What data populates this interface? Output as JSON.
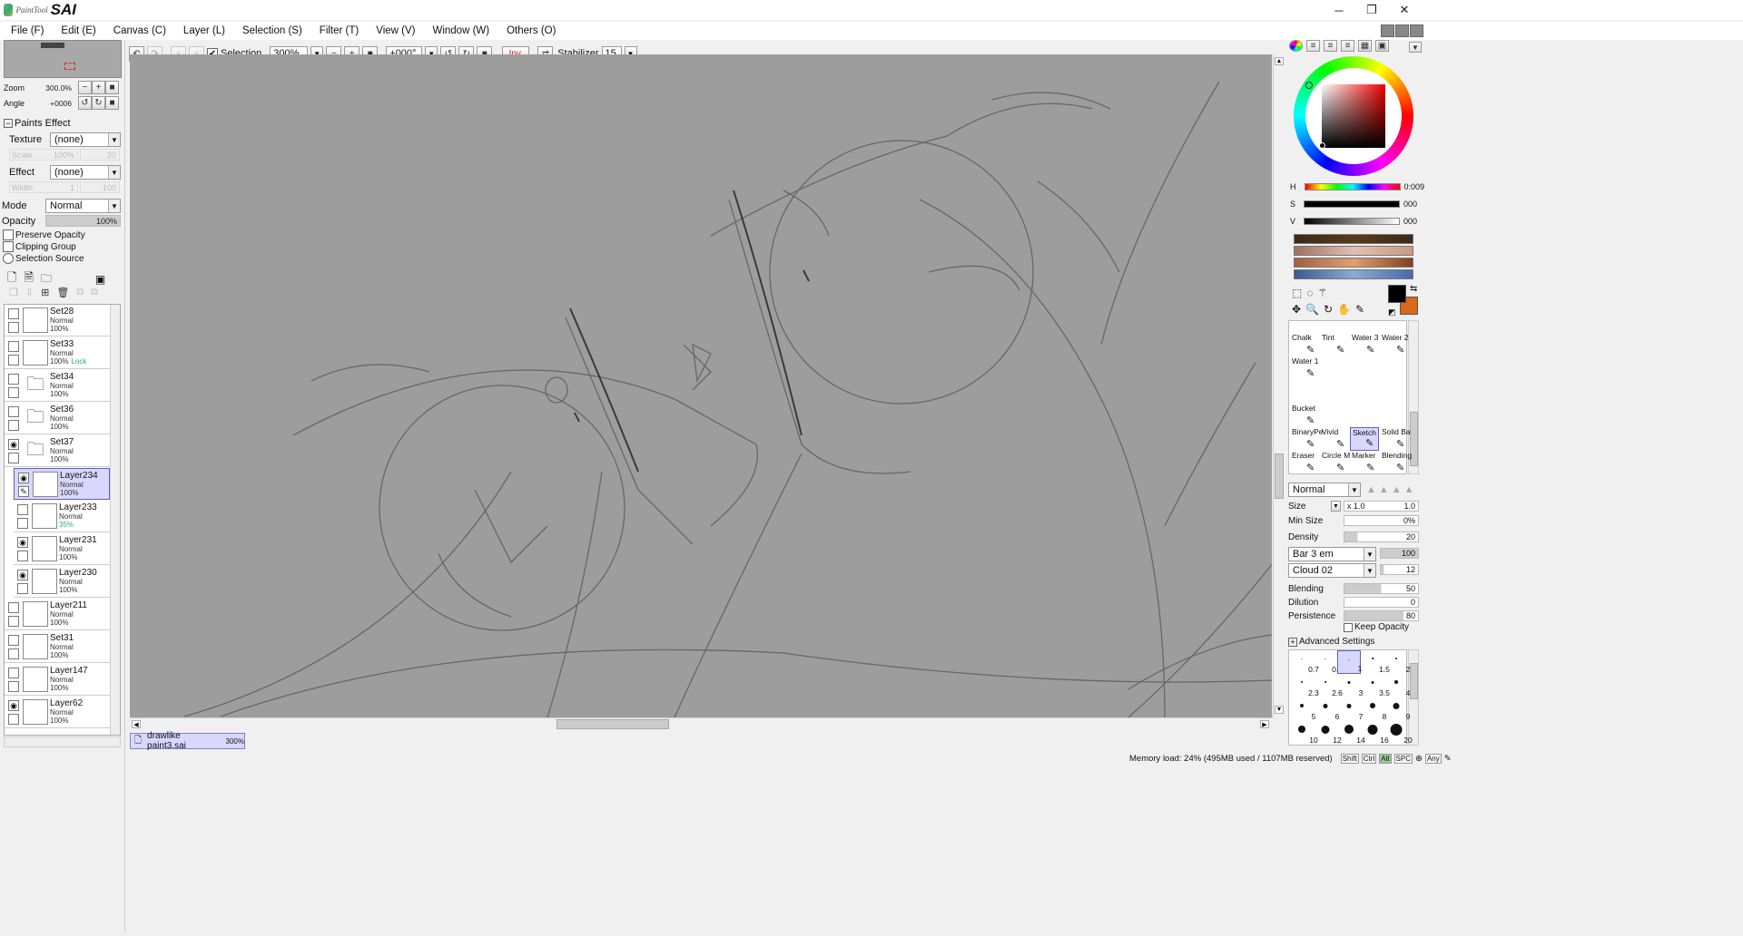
{
  "app": {
    "logo_small": "PaintTool",
    "logo_big": "SAI",
    "window_controls": [
      "minimize-icon",
      "restore-icon",
      "close-icon"
    ]
  },
  "menu": [
    "File (F)",
    "Edit (E)",
    "Canvas (C)",
    "Layer (L)",
    "Selection (S)",
    "Filter (T)",
    "View (V)",
    "Window (W)",
    "Others (O)"
  ],
  "toolbar": {
    "selection_label": "Selection",
    "selection_checked": true,
    "zoom_value": "300%",
    "angle_value": "+000°",
    "inv_label": "Inv.",
    "stabilizer_label": "Stabilizer",
    "stabilizer_value": "15"
  },
  "navigator": {
    "zoom_label": "Zoom",
    "zoom_value": "300.0%",
    "angle_label": "Angle",
    "angle_value": "+0006"
  },
  "paints_effect": {
    "header": "Paints Effect",
    "texture_label": "Texture",
    "texture_value": "(none)",
    "scale_label": "Scale",
    "scale_value": "100%",
    "scale_num": "20",
    "effect_label": "Effect",
    "effect_value": "(none)",
    "width_label": "Width",
    "width_value": "1",
    "width_num": "100"
  },
  "layer_props": {
    "mode_label": "Mode",
    "mode_value": "Normal",
    "opacity_label": "Opacity",
    "opacity_value": "100%",
    "preserve_opacity": "Preserve Opacity",
    "clipping_group": "Clipping Group",
    "selection_source": "Selection Source"
  },
  "layers": [
    {
      "name": "Set28",
      "mode": "Normal",
      "opacity": "100%",
      "visible": false,
      "folder": false,
      "indent": false,
      "lock": ""
    },
    {
      "name": "Set33",
      "mode": "Normal",
      "opacity": "100%",
      "visible": false,
      "folder": false,
      "indent": false,
      "lock": "Lock"
    },
    {
      "name": "Set34",
      "mode": "Normal",
      "opacity": "100%",
      "visible": false,
      "folder": true,
      "indent": false,
      "lock": ""
    },
    {
      "name": "Set36",
      "mode": "Normal",
      "opacity": "100%",
      "visible": false,
      "folder": true,
      "indent": false,
      "lock": ""
    },
    {
      "name": "Set37",
      "mode": "Normal",
      "opacity": "100%",
      "visible": true,
      "folder": true,
      "indent": false,
      "lock": ""
    },
    {
      "name": "Layer234",
      "mode": "Normal",
      "opacity": "100%",
      "visible": true,
      "folder": false,
      "indent": true,
      "lock": "",
      "selected": true
    },
    {
      "name": "Layer233",
      "mode": "Normal",
      "opacity": "35%",
      "visible": false,
      "folder": false,
      "indent": true,
      "lock": ""
    },
    {
      "name": "Layer231",
      "mode": "Normal",
      "opacity": "100%",
      "visible": true,
      "folder": false,
      "indent": true,
      "lock": ""
    },
    {
      "name": "Layer230",
      "mode": "Normal",
      "opacity": "100%",
      "visible": true,
      "folder": false,
      "indent": true,
      "lock": ""
    },
    {
      "name": "Layer211",
      "mode": "Normal",
      "opacity": "100%",
      "visible": false,
      "folder": false,
      "indent": false,
      "lock": ""
    },
    {
      "name": "Set31",
      "mode": "Normal",
      "opacity": "100%",
      "visible": false,
      "folder": false,
      "indent": false,
      "lock": ""
    },
    {
      "name": "Layer147",
      "mode": "Normal",
      "opacity": "100%",
      "visible": false,
      "folder": false,
      "indent": false,
      "lock": ""
    },
    {
      "name": "Layer62",
      "mode": "Normal",
      "opacity": "100%",
      "visible": true,
      "folder": false,
      "indent": false,
      "lock": ""
    }
  ],
  "document_tab": {
    "name": "drawlike paint3.sai",
    "zoom": "300%"
  },
  "color": {
    "h_label": "H",
    "h_value": "0:009",
    "s_label": "S",
    "s_value": "000",
    "v_label": "V",
    "v_value": "000",
    "primary": "#000000",
    "secondary": "#d86a1a",
    "swatches": [
      "#3a2a1a",
      "#c89a84",
      "#c8845a",
      "#4a6aa8"
    ]
  },
  "brushes": [
    {
      "name": "Chalk",
      "active": false
    },
    {
      "name": "Tint",
      "active": false
    },
    {
      "name": "Water 3",
      "active": false
    },
    {
      "name": "Water 2",
      "active": false
    },
    {
      "name": "Water 1",
      "active": false
    },
    {
      "name": "Bucket",
      "active": false
    },
    {
      "name": "BinaryPe",
      "active": false
    },
    {
      "name": "Vivid",
      "active": false
    },
    {
      "name": "Sketch",
      "active": true
    },
    {
      "name": "Solid Ba",
      "active": false
    },
    {
      "name": "Eraser",
      "active": false
    },
    {
      "name": "Circle M",
      "active": false
    },
    {
      "name": "Marker",
      "active": false
    },
    {
      "name": "Blending",
      "active": false
    }
  ],
  "brush_props": {
    "mode": "Normal",
    "size_label": "Size",
    "size_mult": "x 1.0",
    "size_value": "1.0",
    "min_size_label": "Min Size",
    "min_size_value": "0%",
    "density_label": "Density",
    "density_value": "20",
    "shape_value": "Bar 3 em",
    "shape_num": "100",
    "texture_value": "Cloud 02",
    "texture_num": "12",
    "blending_label": "Blending",
    "blending_value": "50",
    "dilution_label": "Dilution",
    "dilution_value": "0",
    "persistence_label": "Persistence",
    "persistence_value": "80",
    "keep_opacity": "Keep Opacity",
    "advanced": "Advanced Settings"
  },
  "brush_sizes": [
    "0.7",
    "0.8",
    "1",
    "1.5",
    "2",
    "2.3",
    "2.6",
    "3",
    "3.5",
    "4",
    "5",
    "6",
    "7",
    "8",
    "9",
    "10",
    "12",
    "14",
    "16",
    "20"
  ],
  "status": {
    "memory": "Memory load: 24% (495MB used / 1107MB reserved)",
    "keys": [
      "Shift",
      "Ctrl",
      "Alt",
      "SPC"
    ],
    "any": "Any"
  }
}
